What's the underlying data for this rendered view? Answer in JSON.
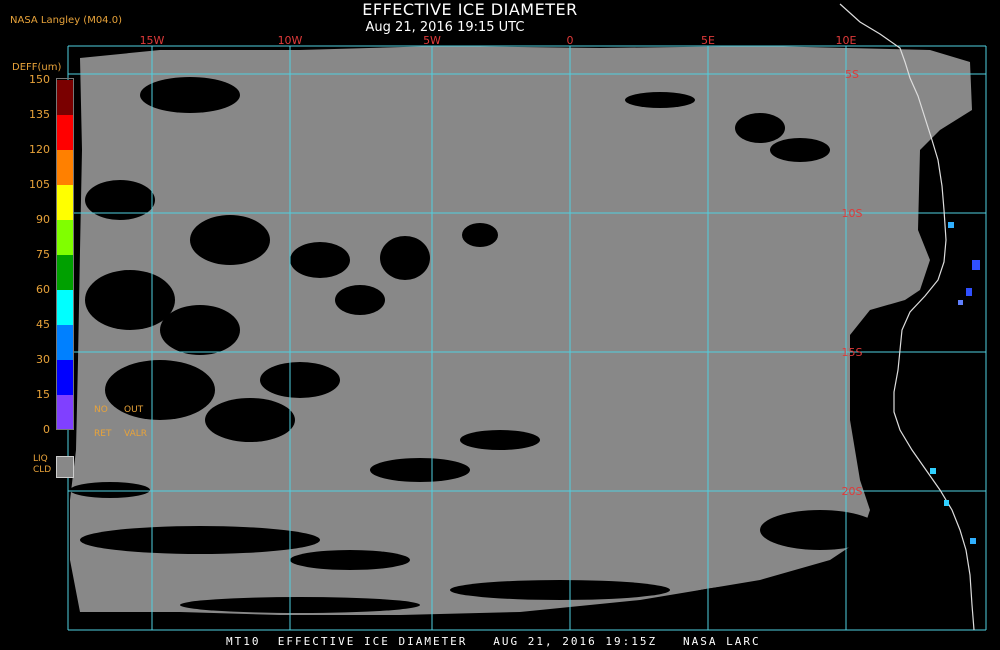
{
  "header": {
    "producer": "NASA Langley (M04.0)",
    "title": "EFFECTIVE ICE DIAMETER",
    "subtitle": "Aug 21, 2016 19:15 UTC"
  },
  "footer": {
    "text": "MT10  EFFECTIVE ICE DIAMETER   AUG 21, 2016 19:15Z   NASA LARC"
  },
  "legend": {
    "title": "DEFF(um)",
    "ticks": [
      "150",
      "135",
      "120",
      "105",
      "90",
      "75",
      "60",
      "45",
      "30",
      "15",
      "0"
    ],
    "colors": [
      "#7a0000",
      "#ff0000",
      "#ff8000",
      "#ffff00",
      "#80ff00",
      "#00a000",
      "#00ffff",
      "#0080ff",
      "#0000ff",
      "#8040ff"
    ],
    "no_ret": "NO RET",
    "out_valr": "OUT VALR",
    "no_ret_color": "#7f2fd0",
    "liq_cld": "LIQ CLD",
    "liq_cld_color": "#888888"
  },
  "map": {
    "longitude_labels": [
      "15W",
      "10W",
      "5W",
      "0",
      "5E",
      "10E"
    ],
    "latitude_labels": [
      "5S",
      "10S",
      "15S",
      "20S"
    ],
    "grid_color": "#4fd0e0",
    "label_color": "#e03a3a",
    "cloud_color": "#888888",
    "clear_color": "#000000"
  }
}
